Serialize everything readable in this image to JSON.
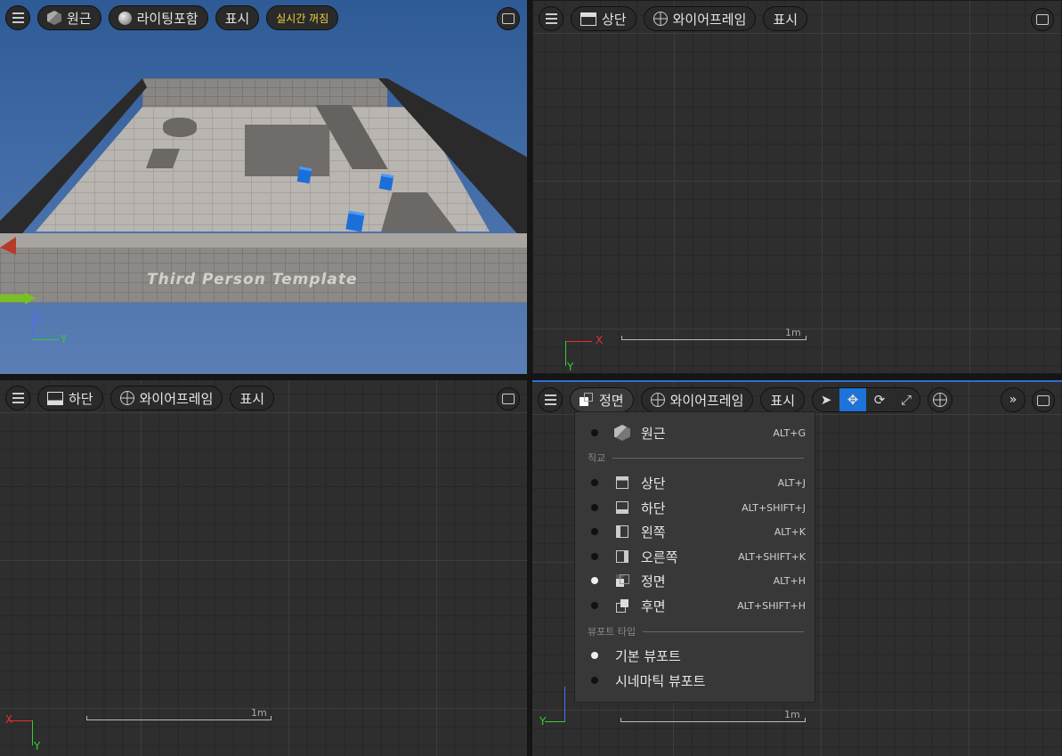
{
  "viewports": {
    "perspective": {
      "view_label": "원근",
      "lighting_label": "라이팅포함",
      "show_label": "표시",
      "realtime_label": "실시간 꺼짐",
      "scene_text": "Third Person Template",
      "axis_z": "Z",
      "axis_y": "Y"
    },
    "top": {
      "view_label": "상단",
      "mode_label": "와이어프레임",
      "show_label": "표시",
      "axis_x": "X",
      "axis_y": "Y",
      "scale_label": "1m"
    },
    "bottom": {
      "view_label": "하단",
      "mode_label": "와이어프레임",
      "show_label": "표시",
      "axis_x": "X",
      "axis_y": "Y",
      "scale_label": "1m"
    },
    "front": {
      "view_label": "정면",
      "mode_label": "와이어프레임",
      "show_label": "표시",
      "axis_y": "Y",
      "scale_label": "1m"
    }
  },
  "view_menu": {
    "perspective": {
      "label": "원근",
      "shortcut": "ALT+G"
    },
    "ortho_section": "직교",
    "ortho_items": [
      {
        "label": "상단",
        "shortcut": "ALT+J",
        "icon": "top-view-icon",
        "selected": false
      },
      {
        "label": "하단",
        "shortcut": "ALT+SHIFT+J",
        "icon": "bottom-view-icon",
        "selected": false
      },
      {
        "label": "왼쪽",
        "shortcut": "ALT+K",
        "icon": "left-view-icon",
        "selected": false
      },
      {
        "label": "오른쪽",
        "shortcut": "ALT+SHIFT+K",
        "icon": "right-view-icon",
        "selected": false
      },
      {
        "label": "정면",
        "shortcut": "ALT+H",
        "icon": "front-view-icon",
        "selected": true
      },
      {
        "label": "후면",
        "shortcut": "ALT+SHIFT+H",
        "icon": "back-view-icon",
        "selected": false
      }
    ],
    "viewport_type_section": "뷰포트 타입",
    "viewport_types": [
      {
        "label": "기본 뷰포트",
        "selected": true
      },
      {
        "label": "시네마틱 뷰포트",
        "selected": false
      }
    ]
  },
  "colors": {
    "accent": "#1d73d8",
    "realtime_text": "#f2d240",
    "axis_x": "#e03030",
    "axis_y": "#30d030",
    "axis_z": "#4a6cff"
  }
}
